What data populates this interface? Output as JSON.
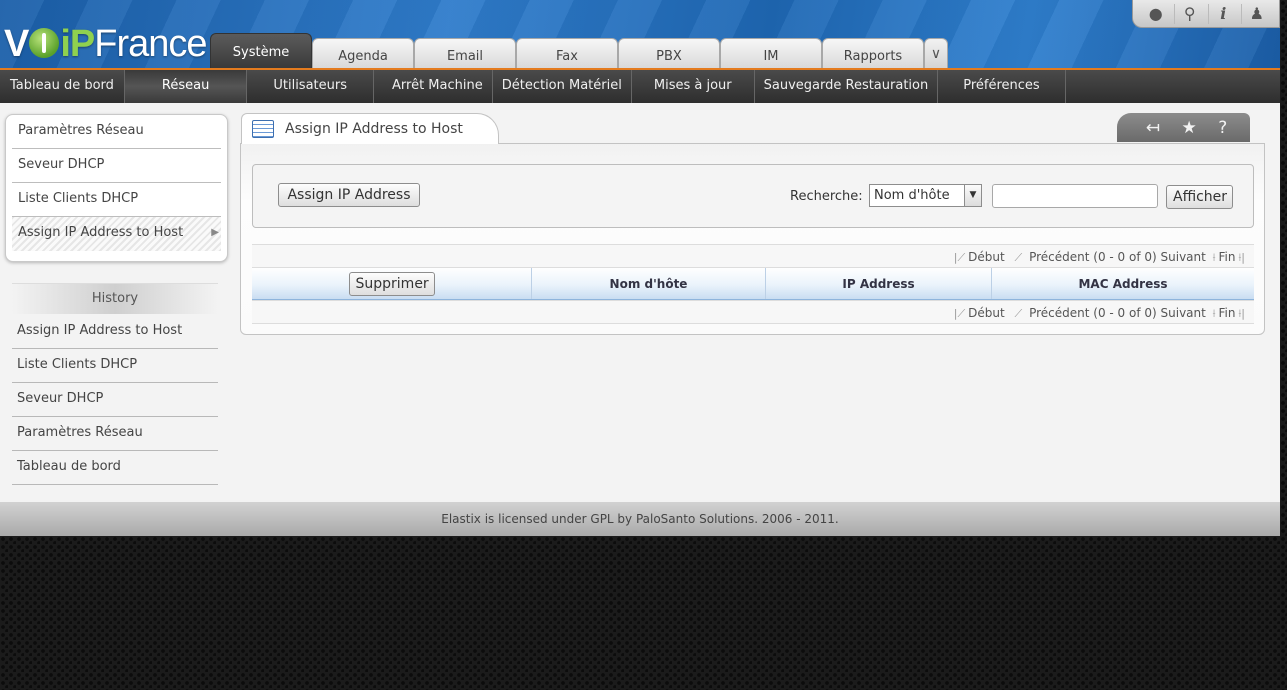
{
  "brand": {
    "logo_prefix": "V",
    "logo_p": "iP",
    "logo_word": "France"
  },
  "top_icons": [
    "droplet-icon",
    "search-icon",
    "info-icon",
    "user-icon"
  ],
  "tabs": [
    {
      "label": "Système",
      "active": true
    },
    {
      "label": "Agenda"
    },
    {
      "label": "Email"
    },
    {
      "label": "Fax"
    },
    {
      "label": "PBX"
    },
    {
      "label": "IM"
    },
    {
      "label": "Rapports"
    }
  ],
  "tab_more_glyph": "∨",
  "subnav": [
    {
      "label": "Tableau de bord"
    },
    {
      "label": "Réseau",
      "active": true
    },
    {
      "label": "Utilisateurs"
    },
    {
      "label": "Arrêt Machine"
    },
    {
      "label": "Détection Matériel"
    },
    {
      "label": "Mises à jour"
    },
    {
      "label": "Sauvegarde Restauration"
    },
    {
      "label": "Préférences"
    }
  ],
  "left_menu": [
    {
      "label": "Paramètres Réseau"
    },
    {
      "label": "Seveur DHCP"
    },
    {
      "label": "Liste Clients DHCP"
    },
    {
      "label": "Assign IP Address to Host",
      "active": true
    }
  ],
  "history": {
    "title": "History",
    "items": [
      "Assign IP Address to Host",
      "Liste Clients DHCP",
      "Seveur DHCP",
      "Paramètres Réseau",
      "Tableau de bord"
    ]
  },
  "panel": {
    "title": "Assign IP Address to Host",
    "tools": [
      "↤",
      "★",
      "?"
    ],
    "assign_button": "Assign IP Address",
    "search_label": "Recherche:",
    "search_select_value": "Nom d'hôte",
    "search_input_value": "",
    "show_button": "Afficher"
  },
  "pager": {
    "first": "Début",
    "prev": "Précédent",
    "range": "(0 - 0 of 0)",
    "next": "Suivant",
    "last": "Fin"
  },
  "grid": {
    "delete_button": "Supprimer",
    "columns": [
      "Nom d'hôte",
      "IP Address",
      "MAC Address"
    ]
  },
  "footer": {
    "text": "Elastix is licensed under GPL by PaloSanto Solutions. 2006 - 2011."
  },
  "colors": {
    "accent": "#e47b1e",
    "header_blue": "#2f7ccb",
    "logo_green": "#8fd14f"
  }
}
